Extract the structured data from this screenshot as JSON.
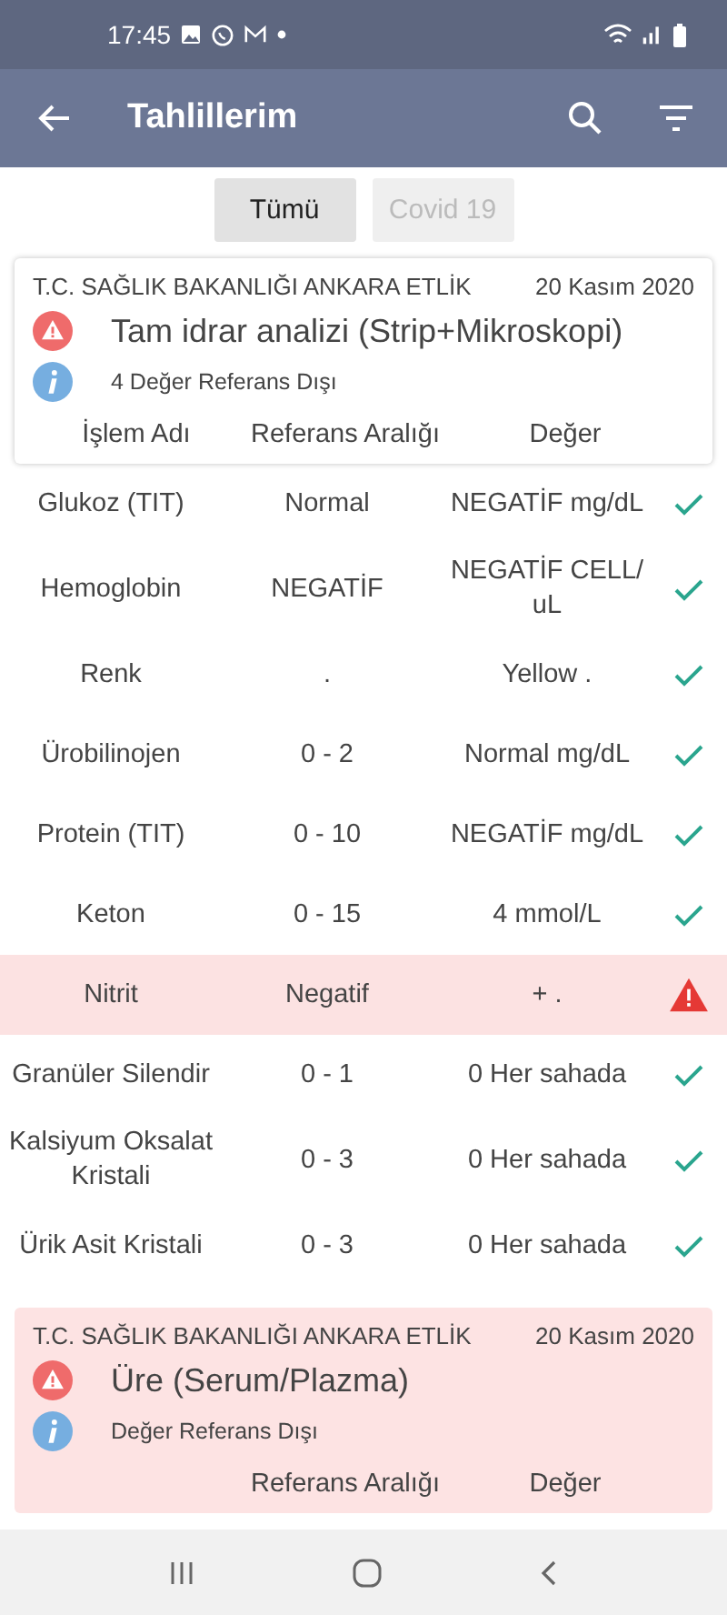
{
  "status_bar": {
    "time": "17:45"
  },
  "app_bar": {
    "title": "Tahlillerim"
  },
  "filters": [
    {
      "label": "Tümü",
      "selected": true
    },
    {
      "label": "Covid 19",
      "selected": false
    }
  ],
  "results": [
    {
      "institution": "T.C. SAĞLIK BAKANLIĞI ANKARA ETLİK",
      "date": "20 Kasım 2020",
      "test": "Tam idrar analizi (Strip+Mikroskopi)",
      "note": "4 Değer Referans Dışı",
      "out_of_range": false,
      "columns": {
        "name": "İşlem Adı",
        "reference": "Referans Aralığı",
        "value": "Değer"
      },
      "rows": [
        {
          "name": "Glukoz (TIT)",
          "reference": "Normal",
          "value": "NEGATİF mg/dL",
          "out_of_range": false
        },
        {
          "name": "Hemoglobin",
          "reference": "NEGATİF",
          "value": "NEGATİF CELL/ uL",
          "out_of_range": false
        },
        {
          "name": "Renk",
          "reference": ".",
          "value": "Yellow .",
          "out_of_range": false
        },
        {
          "name": "Ürobilinojen",
          "reference": "0 - 2",
          "value": "Normal mg/dL",
          "out_of_range": false
        },
        {
          "name": "Protein (TIT)",
          "reference": "0 - 10",
          "value": "NEGATİF mg/dL",
          "out_of_range": false
        },
        {
          "name": "Keton",
          "reference": "0 - 15",
          "value": "4 mmol/L",
          "out_of_range": false
        },
        {
          "name": "Nitrit",
          "reference": "Negatif",
          "value": "+ .",
          "out_of_range": true
        },
        {
          "name": "Granüler Silendir",
          "reference": "0 - 1",
          "value": "0 Her sahada",
          "out_of_range": false
        },
        {
          "name": "Kalsiyum Oksalat Kristali",
          "reference": "0 - 3",
          "value": "0 Her sahada",
          "out_of_range": false
        },
        {
          "name": "Ürik Asit Kristali",
          "reference": "0 - 3",
          "value": "0 Her sahada",
          "out_of_range": false
        }
      ]
    },
    {
      "institution": "T.C. SAĞLIK BAKANLIĞI ANKARA ETLİK",
      "date": "20 Kasım 2020",
      "test": "Üre (Serum/Plazma)",
      "note": "Değer Referans Dışı",
      "out_of_range": true,
      "columns": {
        "reference": "Referans Aralığı",
        "value": "Değer"
      }
    }
  ]
}
